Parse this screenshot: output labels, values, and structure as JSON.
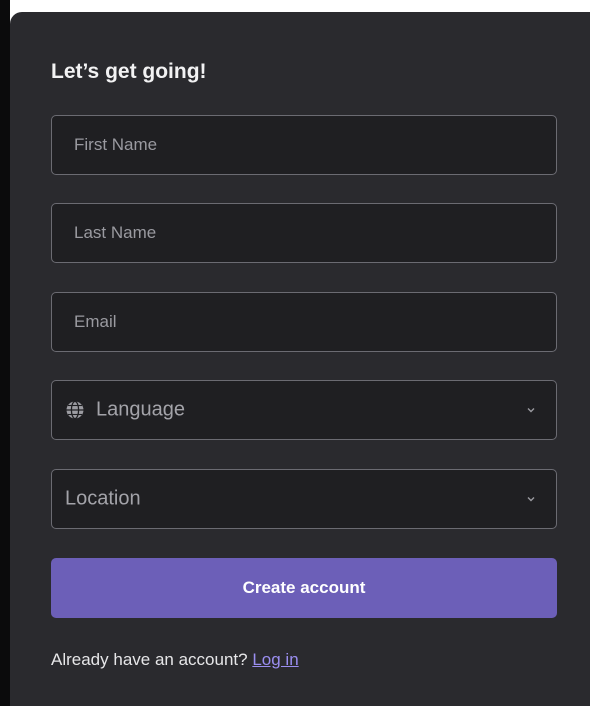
{
  "form": {
    "title": "Let’s get going!",
    "first_name_placeholder": "First Name",
    "last_name_placeholder": "Last Name",
    "email_placeholder": "Email",
    "language_label": "Language",
    "location_label": "Location",
    "submit_label": "Create account",
    "login_prompt": "Already have an account?",
    "login_link": "Log in"
  },
  "icons": {
    "language": "globe-icon",
    "dropdown": "chevron-down-icon"
  },
  "colors": {
    "card_background": "#2a2a2e",
    "field_background": "#1f1f22",
    "accent": "#6c5fb8",
    "link": "#9a8ef0"
  }
}
